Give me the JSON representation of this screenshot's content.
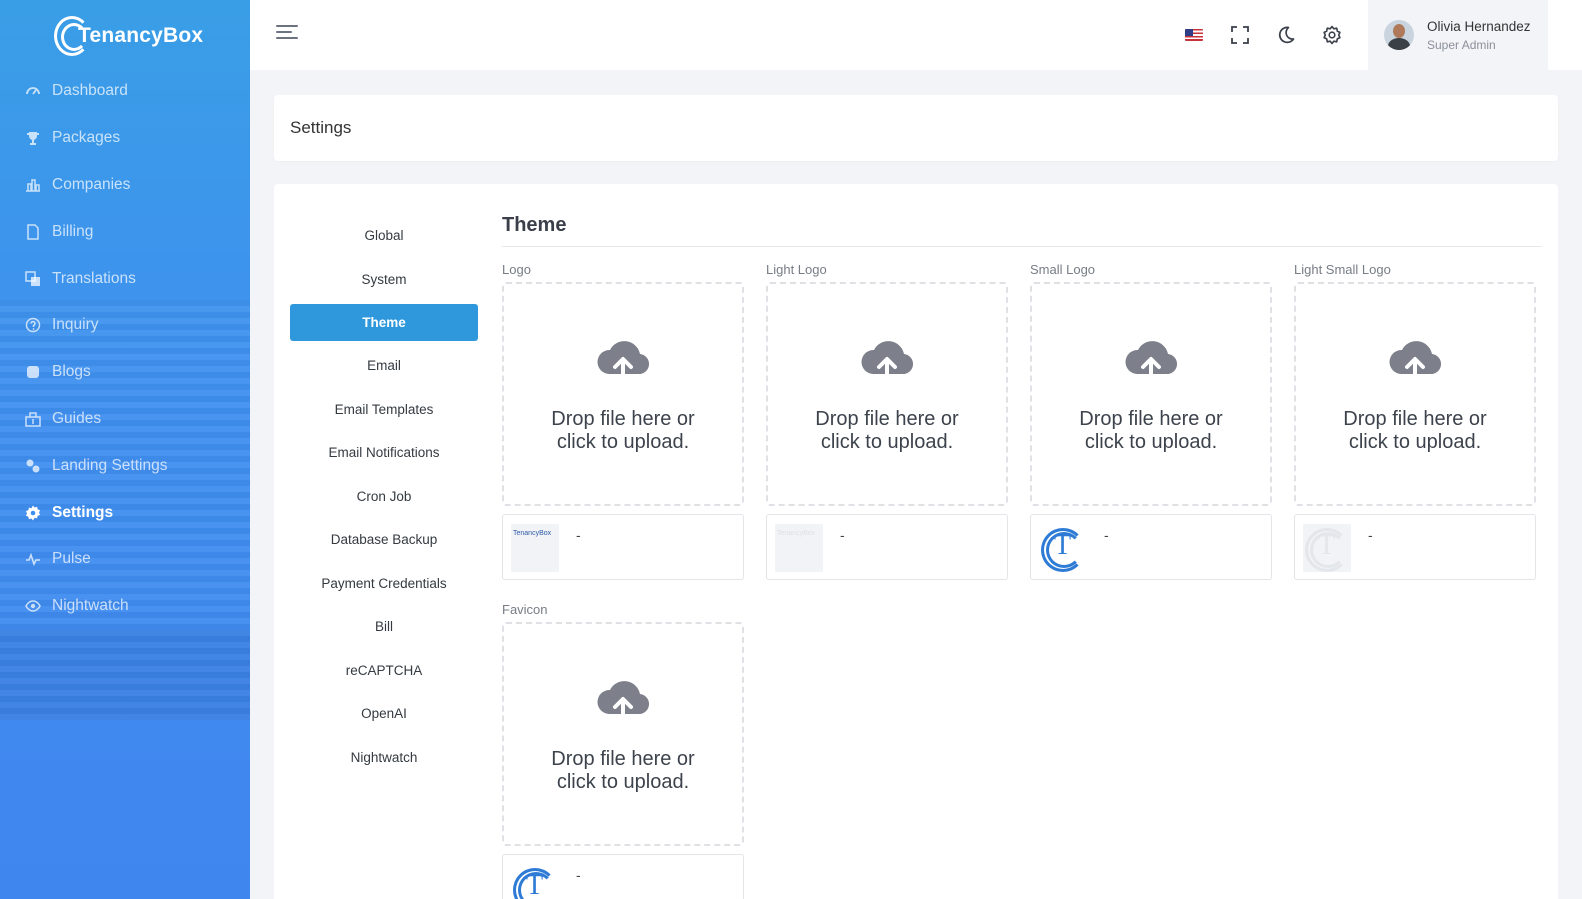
{
  "brand": {
    "name": "TenancyBox"
  },
  "sidebar": {
    "items": [
      {
        "label": "Dashboard",
        "icon": "gauge-icon"
      },
      {
        "label": "Packages",
        "icon": "trophy-icon"
      },
      {
        "label": "Companies",
        "icon": "bar-chart-icon"
      },
      {
        "label": "Billing",
        "icon": "document-icon"
      },
      {
        "label": "Translations",
        "icon": "translate-icon"
      },
      {
        "label": "Inquiry",
        "icon": "question-circle-icon"
      },
      {
        "label": "Blogs",
        "icon": "blog-icon"
      },
      {
        "label": "Guides",
        "icon": "guide-icon"
      },
      {
        "label": "Landing Settings",
        "icon": "cogs-icon"
      },
      {
        "label": "Settings",
        "icon": "gear-icon",
        "active": true
      },
      {
        "label": "Pulse",
        "icon": "pulse-icon"
      },
      {
        "label": "Nightwatch",
        "icon": "eye-icon"
      }
    ]
  },
  "topbar": {
    "icons": [
      "menu-icon",
      "us-flag-icon",
      "fullscreen-icon",
      "moon-icon",
      "gear-icon"
    ],
    "user": {
      "name": "Olivia Hernandez",
      "role": "Super Admin"
    }
  },
  "page": {
    "title": "Settings"
  },
  "settings_tabs": [
    "Global",
    "System",
    "Theme",
    "Email",
    "Email Templates",
    "Email Notifications",
    "Cron Job",
    "Database Backup",
    "Payment Credentials",
    "Bill",
    "reCAPTCHA",
    "OpenAI",
    "Nightwatch"
  ],
  "active_tab": "Theme",
  "theme": {
    "title": "Theme",
    "dropzone_text": "Drop file here or click to upload.",
    "fields": [
      {
        "label": "Logo",
        "preview_value": "-"
      },
      {
        "label": "Light Logo",
        "preview_value": "-"
      },
      {
        "label": "Small Logo",
        "preview_value": "-"
      },
      {
        "label": "Light Small Logo",
        "preview_value": "-"
      },
      {
        "label": "Favicon",
        "preview_value": "-"
      }
    ],
    "preview_logo_text": "TenancyBox",
    "preview_small_logo_letter": "T"
  },
  "colors": {
    "sidebar_gradient_top": "#3a9ee6",
    "sidebar_gradient_bottom": "#4086ef",
    "active_tab": "#2f98dc",
    "upload_icon": "#7d808a",
    "logo_blue": "#2e7bd6"
  }
}
